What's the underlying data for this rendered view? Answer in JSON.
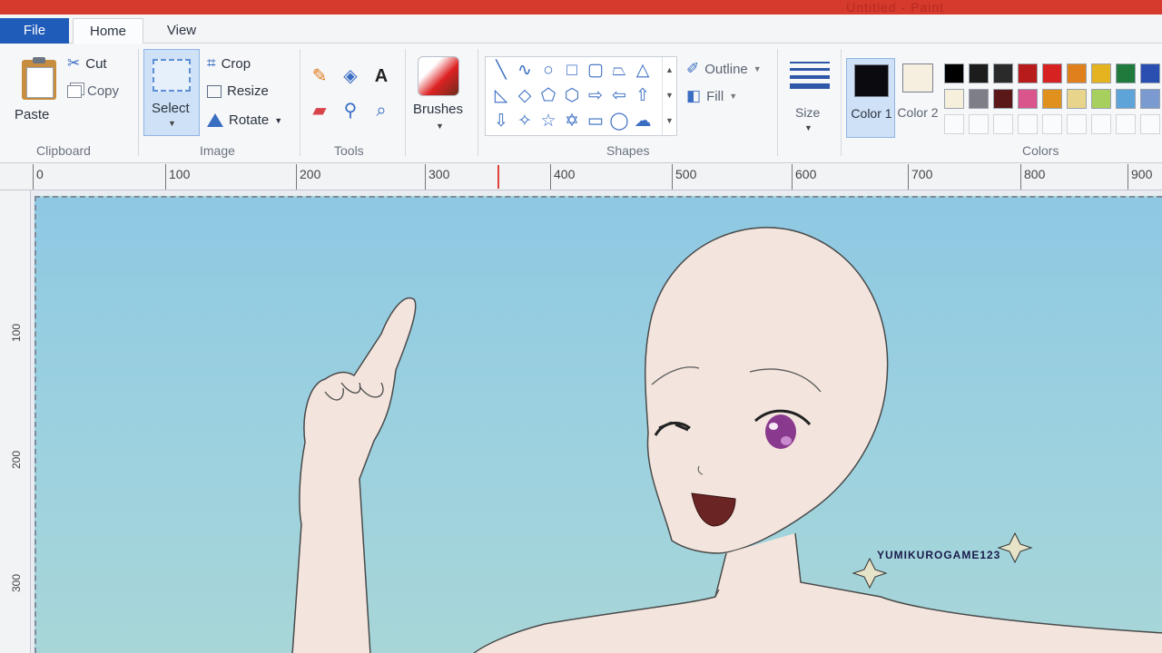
{
  "titlebar": {
    "title": "Untitled - Paint"
  },
  "tabs": {
    "file": "File",
    "home": "Home",
    "view": "View"
  },
  "clipboard": {
    "paste": "Paste",
    "cut": "Cut",
    "copy": "Copy",
    "group": "Clipboard"
  },
  "image": {
    "select": "Select",
    "crop": "Crop",
    "resize": "Resize",
    "rotate": "Rotate",
    "group": "Image"
  },
  "tools": {
    "group": "Tools",
    "text_tool": "A"
  },
  "brushes": {
    "label": "Brushes"
  },
  "shapes": {
    "outline": "Outline",
    "fill": "Fill",
    "group": "Shapes"
  },
  "size": {
    "label": "Size"
  },
  "colors": {
    "color1": "Color 1",
    "color2": "Color 2",
    "group": "Colors",
    "color1_value": "#0a0a0f",
    "color2_value": "#f6efdf",
    "palette_row1": [
      "#000000",
      "#1c1c1c",
      "#2a2a2a",
      "#b81b1b",
      "#d72222",
      "#e0801c",
      "#e6b320",
      "#1f7a3c",
      "#2a4fb0",
      "#2450a8"
    ],
    "palette_row2": [
      "#f5efdc",
      "#7e7e86",
      "#5a1818",
      "#d9558b",
      "#e0901c",
      "#e8d48a",
      "#a6cf5e",
      "#5fa4d8",
      "#7a9ad0",
      "#9b87c9"
    ]
  },
  "ruler": {
    "top_labels": [
      "0",
      "100",
      "200",
      "300",
      "400",
      "500",
      "600",
      "700",
      "800",
      "900"
    ],
    "left_labels": [
      "100",
      "200",
      "300"
    ]
  },
  "drawing": {
    "watermark": "YUMIKUROGAME123"
  }
}
